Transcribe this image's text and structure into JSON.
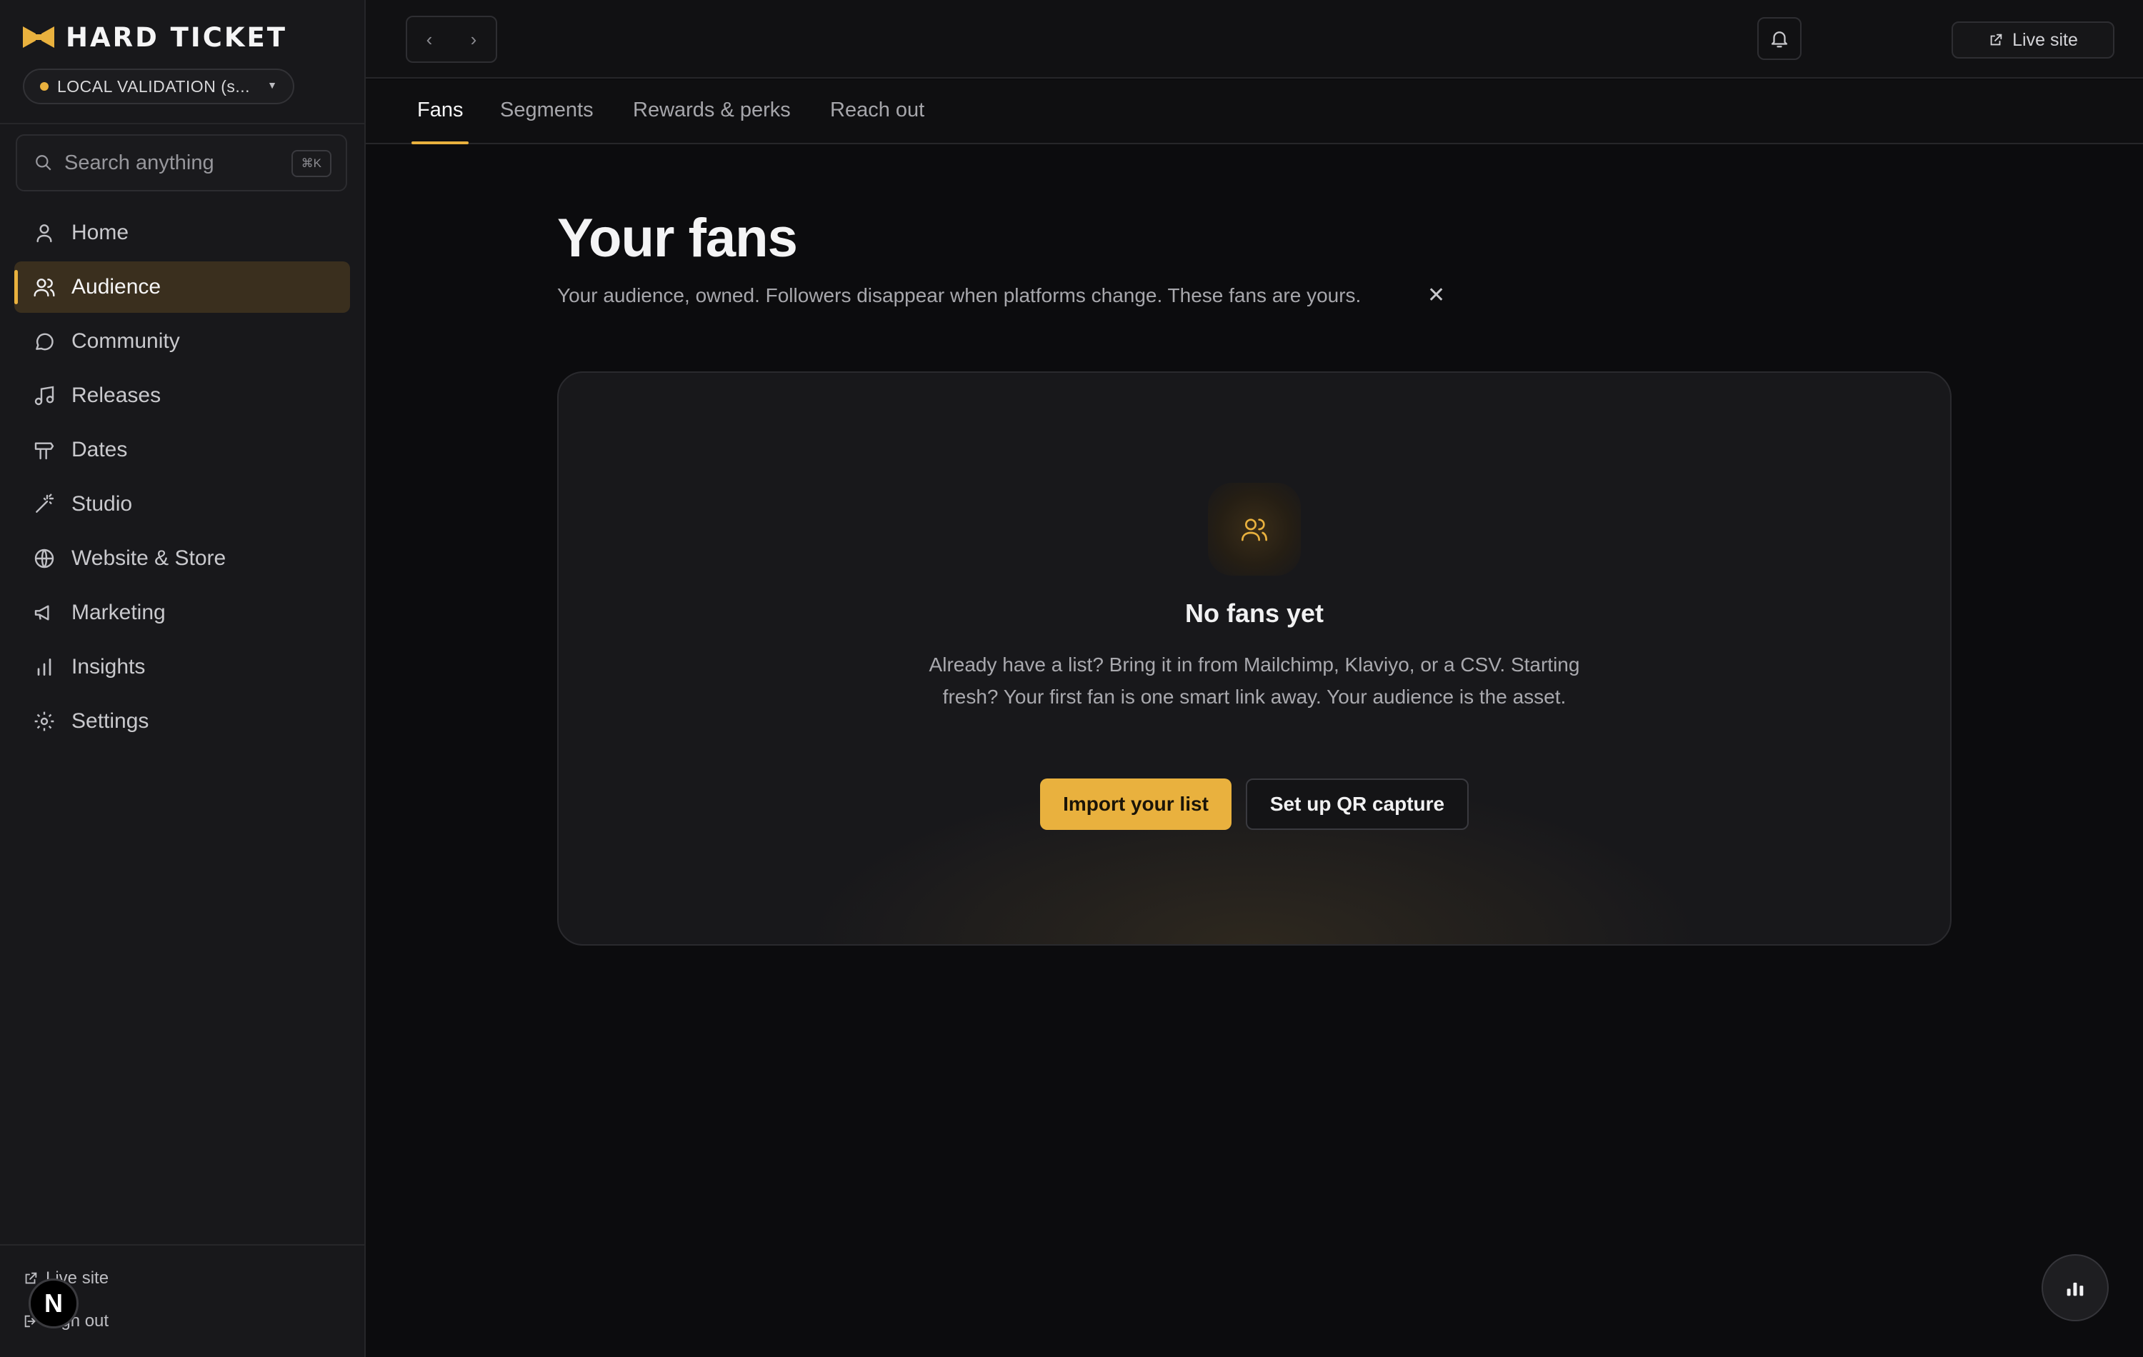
{
  "brand": {
    "name": "HARD TICKET",
    "accent": "#e9b13e"
  },
  "workspace": {
    "label": "LOCAL VALIDATION (s..."
  },
  "search": {
    "placeholder": "Search anything",
    "shortcut": "⌘K"
  },
  "sidebar": {
    "items": [
      {
        "label": "Home",
        "icon": "user-icon",
        "active": false
      },
      {
        "label": "Audience",
        "icon": "users-icon",
        "active": true
      },
      {
        "label": "Community",
        "icon": "chat-bubble-icon",
        "active": false
      },
      {
        "label": "Releases",
        "icon": "music-note-icon",
        "active": false
      },
      {
        "label": "Dates",
        "icon": "signpost-icon",
        "active": false
      },
      {
        "label": "Studio",
        "icon": "magic-wand-icon",
        "active": false
      },
      {
        "label": "Website & Store",
        "icon": "globe-icon",
        "active": false
      },
      {
        "label": "Marketing",
        "icon": "megaphone-icon",
        "active": false
      },
      {
        "label": "Insights",
        "icon": "bar-chart-icon",
        "active": false
      },
      {
        "label": "Settings",
        "icon": "gear-icon",
        "active": false
      }
    ],
    "bottom": {
      "live_site": "Live site",
      "sign_out": "Sign out"
    },
    "avatar_letter": "N"
  },
  "topbar": {
    "back": "‹",
    "forward": "›",
    "live_site": "Live site"
  },
  "tabs": [
    {
      "label": "Fans",
      "active": true
    },
    {
      "label": "Segments",
      "active": false
    },
    {
      "label": "Rewards & perks",
      "active": false
    },
    {
      "label": "Reach out",
      "active": false
    }
  ],
  "main": {
    "title": "Your fans",
    "subtitle": "Your audience, owned. Followers disappear when platforms change. These fans are yours.",
    "dismiss": "✕",
    "empty_state": {
      "title": "No fans yet",
      "description": "Already have a list? Bring it in from Mailchimp, Klaviyo, or a CSV. Starting fresh? Your first fan is one smart link away. Your audience is the asset.",
      "primary_button": "Import your list",
      "secondary_button": "Set up QR capture"
    }
  }
}
